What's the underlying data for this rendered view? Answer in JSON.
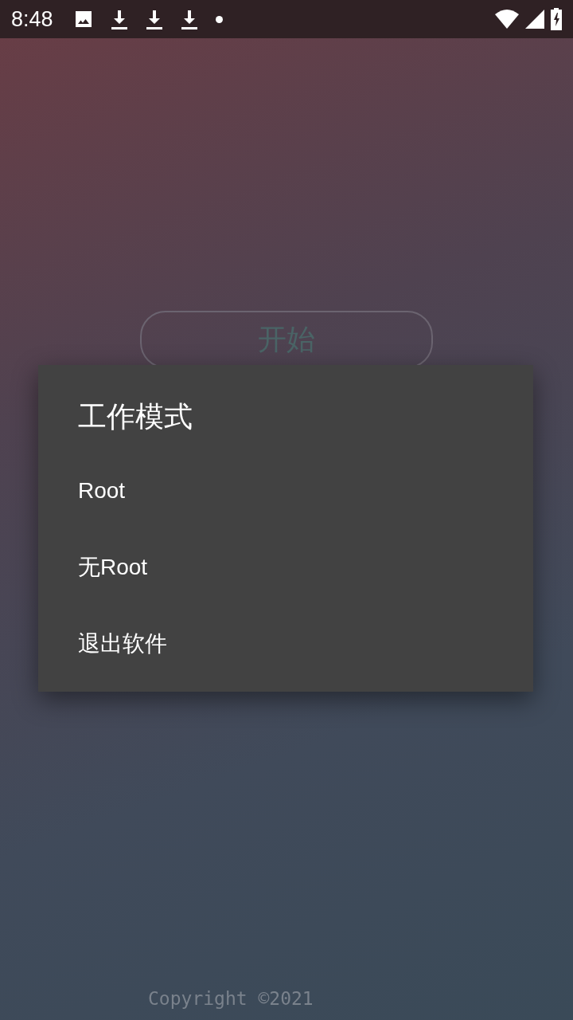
{
  "status_bar": {
    "time": "8:48"
  },
  "start_button": {
    "label": "开始"
  },
  "dialog": {
    "title": "工作模式",
    "options": [
      {
        "label": "Root"
      },
      {
        "label": "无Root"
      },
      {
        "label": "退出软件"
      }
    ]
  },
  "footer": {
    "copyright": "Copyright ©2021"
  }
}
